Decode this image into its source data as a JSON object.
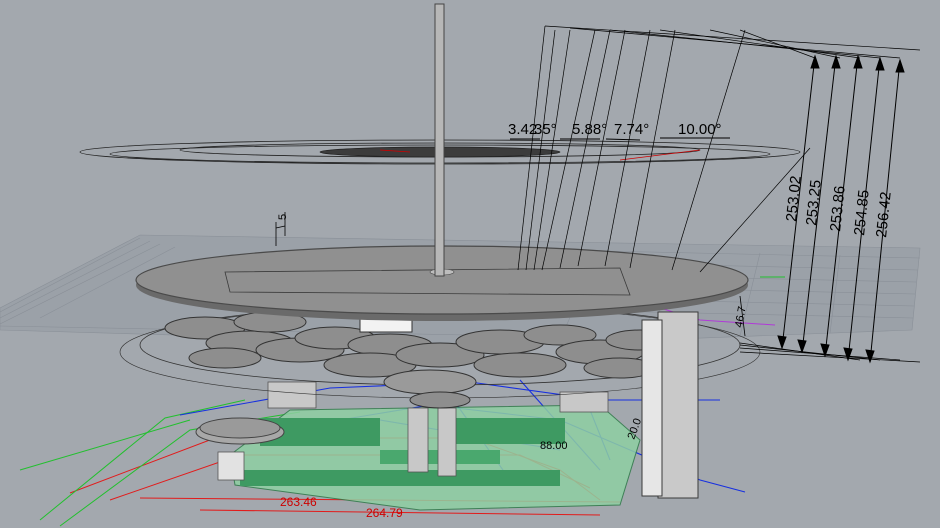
{
  "viewport": {
    "background": "#a3a8ae"
  },
  "angle_dims": [
    "3.42",
    "35°",
    "5.88°",
    "7.74°",
    "10.00°"
  ],
  "radius_dims": [
    "253.02",
    "253.25",
    "253.86",
    "254.85",
    "256.42"
  ],
  "small_dims": {
    "height": "46.7",
    "mast": "5",
    "inner": "88.00",
    "side": "20.0"
  },
  "bottom_dims": [
    "263.46",
    "264.79"
  ],
  "colors": {
    "disc": "#909090",
    "disc_edge": "#4a4a4a",
    "base_green": "#8fcfa3",
    "wire_red": "#e21b1b",
    "wire_green": "#22c02e",
    "wire_blue": "#1730e0",
    "wire_magenta": "#b03ad8"
  }
}
